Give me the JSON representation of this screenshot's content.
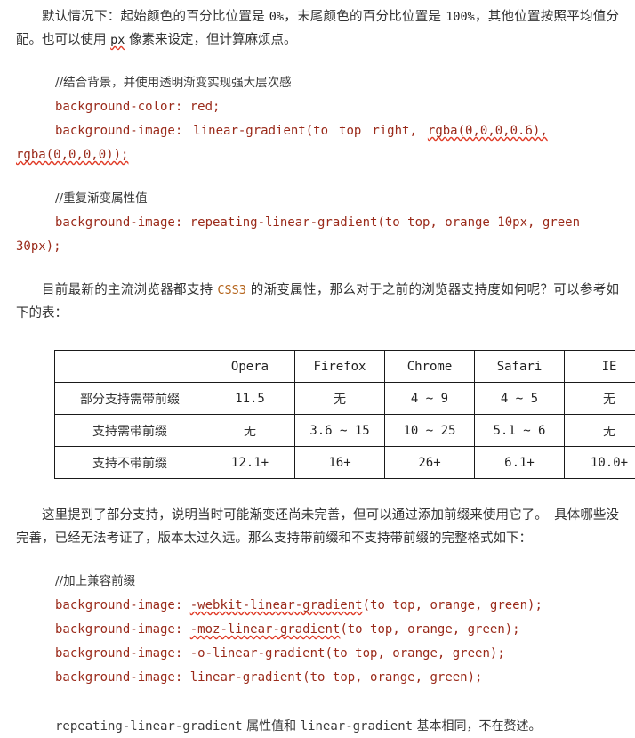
{
  "document": {
    "colors": {
      "code": "#9a2a1a",
      "text": "#333333",
      "keyword_orange": "#b5651d",
      "spellcheck_underline": "#e03a26",
      "table_border": "#1a1a1a",
      "background": "#ffffff"
    },
    "paragraph_1": {
      "lead": "默认情况下：起始颜色的百分比位置是 ",
      "value_start": "0%",
      "mid": "，末尾颜色的百分比位置是 ",
      "value_end": "100%",
      "tail_a": "，其他位置按照平均值分配。也可以使用 ",
      "unit_px": "px",
      "tail_b": " 像素来设定，但计算麻烦点。"
    },
    "code_block_1": {
      "comment": "//结合背景，并使用透明渐变实现强大层次感",
      "line_1": "background-color: red;",
      "line_2_prop": "background-image:",
      "line_2_value_a": "linear-gradient(to",
      "line_2_value_b": "top",
      "line_2_value_c": "right,",
      "line_2_value_d": "rgba(0,0,0,0.6),",
      "line_2_wrap": "rgba(0,0,0,0));"
    },
    "code_block_2": {
      "comment": "//重复渐变属性值",
      "line_1": "background-image: repeating-linear-gradient(to top, orange 10px, green",
      "line_1_wrap": "30px);"
    },
    "paragraph_2": {
      "lead": "目前最新的主流浏览器都支持 ",
      "keyword": "CSS3",
      "tail": " 的渐变属性，那么对于之前的浏览器支持度如何呢？可以参考如下的表："
    },
    "table": {
      "headers": [
        "",
        "Opera",
        "Firefox",
        "Chrome",
        "Safari",
        "IE"
      ],
      "rows": [
        {
          "label": "部分支持需带前缀",
          "cells": [
            "11.5",
            "无",
            "4 ~ 9",
            "4 ~ 5",
            "无"
          ]
        },
        {
          "label": "支持需带前缀",
          "cells": [
            "无",
            "3.6 ~ 15",
            "10 ~ 25",
            "5.1 ~ 6",
            "无"
          ]
        },
        {
          "label": "支持不带前缀",
          "cells": [
            "12.1+",
            "16+",
            "26+",
            "6.1+",
            "10.0+"
          ]
        }
      ]
    },
    "paragraph_3": {
      "text": "这里提到了部分支持，说明当时可能渐变还尚未完善，但可以通过添加前缀来使用它了。　具体哪些没完善，已经无法考证了，版本太过久远。那么支持带前缀和不支持带前缀的完整格式如下："
    },
    "code_block_3": {
      "comment": "//加上兼容前缀",
      "lines": [
        {
          "prop": "background-image:",
          "fn": "-webkit-linear-gradient",
          "args": "(to top, orange, green);",
          "spellcheck": true
        },
        {
          "prop": "background-image:",
          "fn": "-moz-linear-gradient",
          "args": "(to top, orange, green);",
          "spellcheck": true
        },
        {
          "prop": "background-image:",
          "fn": "-o-linear-gradient",
          "args": "(to top, orange, green);",
          "spellcheck": false
        },
        {
          "prop": "background-image:",
          "fn": "linear-gradient",
          "args": "(to top, orange, green);",
          "spellcheck": false
        }
      ]
    },
    "final_line": {
      "mono_a": "repeating-linear-gradient",
      "cn_a": " 属性值和 ",
      "mono_b": "linear-gradient",
      "cn_b": " 基本相同，不在赘述。"
    }
  }
}
